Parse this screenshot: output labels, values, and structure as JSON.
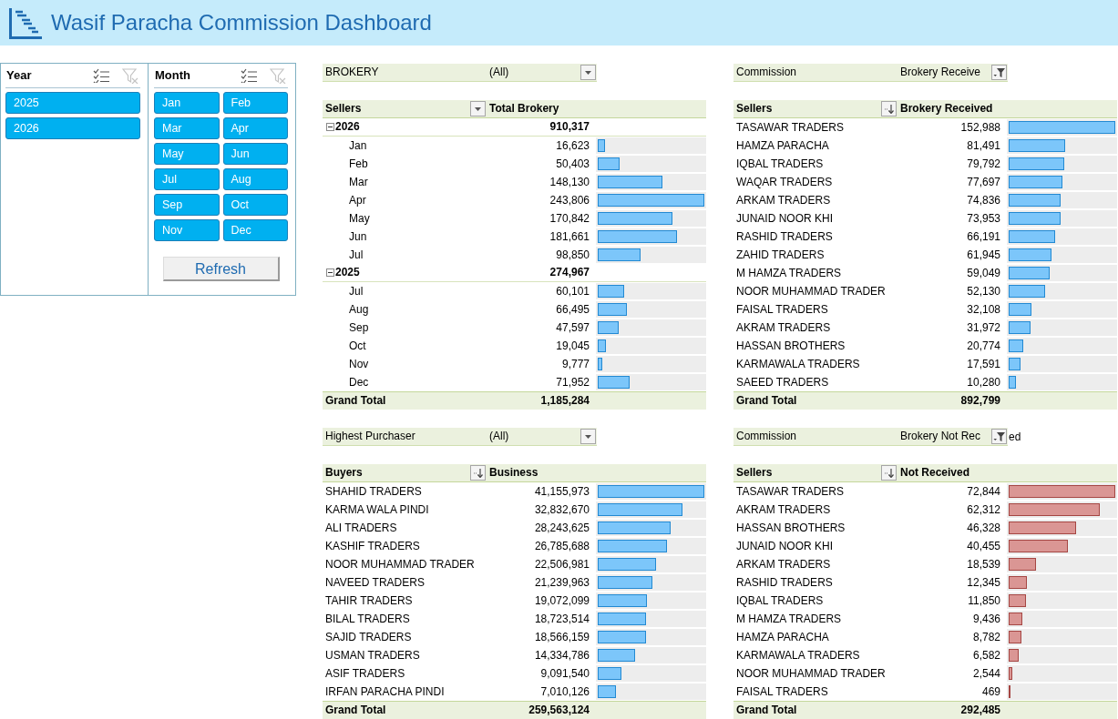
{
  "header": {
    "title": "Wasif Paracha Commission Dashboard"
  },
  "slicers": [
    {
      "title": "Year",
      "kind": "list",
      "clear_disabled": true,
      "items": [
        {
          "label": "2025",
          "selected": true
        },
        {
          "label": "2026",
          "selected": true
        }
      ]
    },
    {
      "title": "Month",
      "kind": "grid",
      "clear_disabled": true,
      "items": [
        {
          "label": "Jan",
          "selected": true
        },
        {
          "label": "Feb",
          "selected": true
        },
        {
          "label": "Mar",
          "selected": true
        },
        {
          "label": "Apr",
          "selected": true
        },
        {
          "label": "May",
          "selected": true
        },
        {
          "label": "Jun",
          "selected": true
        },
        {
          "label": "Jul",
          "selected": true
        },
        {
          "label": "Aug",
          "selected": true
        },
        {
          "label": "Sep",
          "selected": true
        },
        {
          "label": "Oct",
          "selected": true
        },
        {
          "label": "Nov",
          "selected": true
        },
        {
          "label": "Dec",
          "selected": true
        }
      ]
    }
  ],
  "refresh_button": {
    "label": "Refresh"
  },
  "pivot_tables": [
    {
      "kind": "grouped",
      "filter": {
        "label": "BROKERY",
        "value": "(All)",
        "filtered": false
      },
      "columns": [
        "Sellers",
        "Total Brokery"
      ],
      "color": "#7cc6fa",
      "rows": [
        {
          "label": "2026",
          "value": "910,317",
          "expanded": true,
          "children": [
            {
              "label": "Jan",
              "value": "16,623",
              "level": 0.068
            },
            {
              "label": "Feb",
              "value": "50,403",
              "level": 0.207
            },
            {
              "label": "Mar",
              "value": "148,130",
              "level": 0.608
            },
            {
              "label": "Apr",
              "value": "243,806",
              "level": 1.0
            },
            {
              "label": "May",
              "value": "170,842",
              "level": 0.701
            },
            {
              "label": "Jun",
              "value": "181,661",
              "level": 0.745
            },
            {
              "label": "Jul",
              "value": "98,850",
              "level": 0.405
            }
          ]
        },
        {
          "label": "2025",
          "value": "274,967",
          "expanded": true,
          "children": [
            {
              "label": "Jul",
              "value": "60,101",
              "level": 0.247
            },
            {
              "label": "Aug",
              "value": "66,495",
              "level": 0.273
            },
            {
              "label": "Sep",
              "value": "47,597",
              "level": 0.195
            },
            {
              "label": "Oct",
              "value": "19,045",
              "level": 0.078
            },
            {
              "label": "Nov",
              "value": "9,777",
              "level": 0.04
            },
            {
              "label": "Dec",
              "value": "71,952",
              "level": 0.295
            }
          ]
        }
      ],
      "grand_total": {
        "label": "Grand Total",
        "value": "1,185,284"
      }
    },
    {
      "kind": "ranked",
      "filter": {
        "label": "Commission",
        "value": "Brokery Receive",
        "filtered": true
      },
      "columns": [
        "Sellers",
        "Brokery Received"
      ],
      "color": "#7cc6fa",
      "rows": [
        {
          "label": "TASAWAR TRADERS",
          "value": "152,988",
          "level": 1.0
        },
        {
          "label": "HAMZA PARACHA",
          "value": "81,491",
          "level": 0.533
        },
        {
          "label": "IQBAL TRADERS",
          "value": "79,792",
          "level": 0.522
        },
        {
          "label": "WAQAR TRADERS",
          "value": "77,697",
          "level": 0.508
        },
        {
          "label": "ARKAM TRADERS",
          "value": "74,836",
          "level": 0.489
        },
        {
          "label": "JUNAID NOOR KHI",
          "value": "73,953",
          "level": 0.483
        },
        {
          "label": "RASHID TRADERS",
          "value": "66,191",
          "level": 0.433
        },
        {
          "label": "ZAHID TRADERS",
          "value": "61,945",
          "level": 0.405
        },
        {
          "label": "M HAMZA TRADERS",
          "value": "59,049",
          "level": 0.386
        },
        {
          "label": "NOOR MUHAMMAD TRADER",
          "value": "52,130",
          "level": 0.341
        },
        {
          "label": "FAISAL TRADERS",
          "value": "32,108",
          "level": 0.21
        },
        {
          "label": "AKRAM TRADERS",
          "value": "31,972",
          "level": 0.209
        },
        {
          "label": "HASSAN BROTHERS",
          "value": "20,774",
          "level": 0.136
        },
        {
          "label": "KARMAWALA TRADERS",
          "value": "17,591",
          "level": 0.115
        },
        {
          "label": "SAEED TRADERS",
          "value": "10,280",
          "level": 0.067
        }
      ],
      "grand_total": {
        "label": "Grand Total",
        "value": "892,799"
      }
    },
    {
      "kind": "ranked",
      "filter": {
        "label": "Highest Purchaser",
        "value": "(All)",
        "filtered": false
      },
      "columns": [
        "Buyers",
        "Business"
      ],
      "color": "#7cc6fa",
      "rows": [
        {
          "label": "SHAHID TRADERS",
          "value": "41,155,973",
          "level": 1.0
        },
        {
          "label": "KARMA WALA PINDI",
          "value": "32,832,670",
          "level": 0.798
        },
        {
          "label": "ALI TRADERS",
          "value": "28,243,625",
          "level": 0.686
        },
        {
          "label": "KASHIF TRADERS",
          "value": "26,785,688",
          "level": 0.651
        },
        {
          "label": "NOOR MUHAMMAD TRADER",
          "value": "22,506,981",
          "level": 0.547
        },
        {
          "label": "NAVEED TRADERS",
          "value": "21,239,963",
          "level": 0.516
        },
        {
          "label": "TAHIR TRADERS",
          "value": "19,072,099",
          "level": 0.463
        },
        {
          "label": "BILAL TRADERS",
          "value": "18,723,514",
          "level": 0.455
        },
        {
          "label": "SAJID TRADERS",
          "value": "18,566,159",
          "level": 0.451
        },
        {
          "label": "USMAN TRADERS",
          "value": "14,334,786",
          "level": 0.348
        },
        {
          "label": "ASIF TRADERS",
          "value": "9,091,540",
          "level": 0.221
        },
        {
          "label": "IRFAN PARACHA PINDI",
          "value": "7,010,126",
          "level": 0.17
        }
      ],
      "grand_total": {
        "label": "Grand Total",
        "value": "259,563,124"
      }
    },
    {
      "kind": "ranked",
      "filter": {
        "label": "Commission",
        "value": "Brokery Not Rec",
        "value_tail": "ed",
        "filtered": true
      },
      "columns": [
        "Sellers",
        "Not Received"
      ],
      "color": "#da9694",
      "rows": [
        {
          "label": "TASAWAR TRADERS",
          "value": "72,844",
          "level": 1.0
        },
        {
          "label": "AKRAM TRADERS",
          "value": "62,312",
          "level": 0.855
        },
        {
          "label": "HASSAN BROTHERS",
          "value": "46,328",
          "level": 0.636
        },
        {
          "label": "JUNAID NOOR KHI",
          "value": "40,455",
          "level": 0.555
        },
        {
          "label": "ARKAM TRADERS",
          "value": "18,539",
          "level": 0.255
        },
        {
          "label": "RASHID TRADERS",
          "value": "12,345",
          "level": 0.169
        },
        {
          "label": "IQBAL TRADERS",
          "value": "11,850",
          "level": 0.163
        },
        {
          "label": "M HAMZA TRADERS",
          "value": "9,436",
          "level": 0.13
        },
        {
          "label": "HAMZA PARACHA",
          "value": "8,782",
          "level": 0.121
        },
        {
          "label": "KARMAWALA TRADERS",
          "value": "6,582",
          "level": 0.09
        },
        {
          "label": "NOOR MUHAMMAD TRADER",
          "value": "2,544",
          "level": 0.035
        },
        {
          "label": "FAISAL TRADERS",
          "value": "469",
          "level": 0.006
        }
      ],
      "grand_total": {
        "label": "Grand Total",
        "value": "292,485"
      }
    }
  ]
}
